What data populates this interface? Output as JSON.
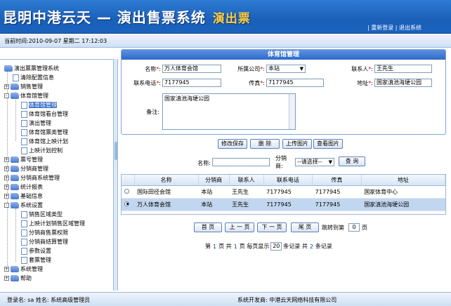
{
  "header": {
    "system_name": "昆明中港云天 — 演出售票系统",
    "logo_text": "演出票",
    "relogin": "重新登录",
    "logout": "退出系统",
    "separator": "|"
  },
  "timebar": {
    "current_time": "当前时间:2010-09-07 星期二 17:12:03"
  },
  "sidebar": {
    "root": "演出票票管理系统",
    "items": [
      "清除配置信息",
      "销售管理",
      "体育馆管理",
      "体育馆管理",
      "体育馆看台管理",
      "演出管理",
      "体育馆票类管理",
      "体育馆上映计划",
      "上映计划控制",
      "票号管理",
      "分销商管理",
      "分销商系统管理",
      "统计报表",
      "基础信息",
      "系统设置",
      "销售区域类型",
      "上映计划销售区域管理",
      "分销商售票权限",
      "分销商结算管理",
      "参数设置",
      "套票管理",
      "系统管理",
      "帮助"
    ]
  },
  "form": {
    "title": "体育馆管理",
    "name_label": "名称",
    "name_value": "万人体育会馆",
    "company_label": "所属公司",
    "company_value": "本站",
    "contact_label": "联系人",
    "contact_value": "王先生",
    "phone_label": "联系电话",
    "phone_value": "7177945",
    "fax_label": "传真",
    "fax_value": "7177945",
    "address_label": "地址",
    "address_value": "国家滇池海埂公园",
    "remark_label": "备注:",
    "remark_value": "国家滇池海埂公园",
    "required_mark": "*",
    "colon": ":"
  },
  "actions": {
    "save": "修改保存",
    "delete": "删 除",
    "upload": "上传图片",
    "view": "查看图片"
  },
  "search": {
    "name_label": "名称:",
    "dist_label": "分销商:",
    "dist_value": "--请选择--",
    "query": "查 询"
  },
  "table": {
    "headers": [
      "名称",
      "分销商",
      "联系人",
      "联系电话",
      "传真",
      "地址"
    ],
    "rows": [
      [
        "国际田径会馆",
        "本站",
        "王先生",
        "7177945",
        "7177945",
        "国家体育中心"
      ],
      [
        "万人体育会馆",
        "本站",
        "王先生",
        "7177945",
        "7177945",
        "国家滇池海埂公园"
      ]
    ]
  },
  "pager": {
    "first": "首 页",
    "prev": "上 一 页",
    "next": "下 一 页",
    "last": "尾 页",
    "jump_label": "跳转到第",
    "jump_value": "0",
    "jump_unit": "页",
    "info_1": "第",
    "current_page": "1",
    "info_2": "页 共",
    "total_pages": "1",
    "info_3": "页 每页显示",
    "per_page": "20",
    "info_4": "条记录 共",
    "total_records": "2",
    "info_5": "条记录"
  },
  "status": {
    "left": "登录名: sa   姓名: 系统高级管理员",
    "right": "系统开发商: 中港云天网络科技有限公司"
  }
}
